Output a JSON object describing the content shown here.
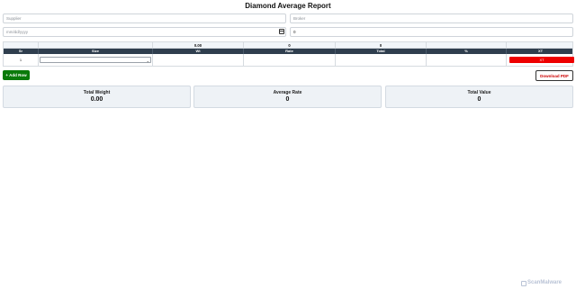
{
  "page": {
    "title": "Diamond Average Report"
  },
  "form": {
    "supplier_placeholder": "Supplier",
    "broker_placeholder": "Broker",
    "date_placeholder": "mm/dd/yyyy",
    "extra_value": "0"
  },
  "table": {
    "totals": {
      "wt": "0.00",
      "rate": "0",
      "total": "0"
    },
    "headers": [
      "Sr",
      "Size",
      "Wt",
      "Rate",
      "Total",
      "%",
      "XT"
    ],
    "rows": [
      {
        "sr": "1",
        "size": "",
        "wt": "",
        "rate": "",
        "total": "",
        "pct": "",
        "action_label": "XT"
      }
    ]
  },
  "actions": {
    "add_row": "+ Add Row",
    "download_pdf": "Download PDF"
  },
  "summary": [
    {
      "label": "Total Weight",
      "value": "0.00"
    },
    {
      "label": "Average Rate",
      "value": "0"
    },
    {
      "label": "Total Value",
      "value": "0"
    }
  ],
  "watermark": {
    "text": "ScanMalware"
  },
  "colors": {
    "header_bg": "#2f3e4e",
    "add_btn": "#0a7a0a",
    "delete_btn": "#ee0000",
    "pdf_text": "#cc0000",
    "card_bg": "#eef2f6"
  }
}
